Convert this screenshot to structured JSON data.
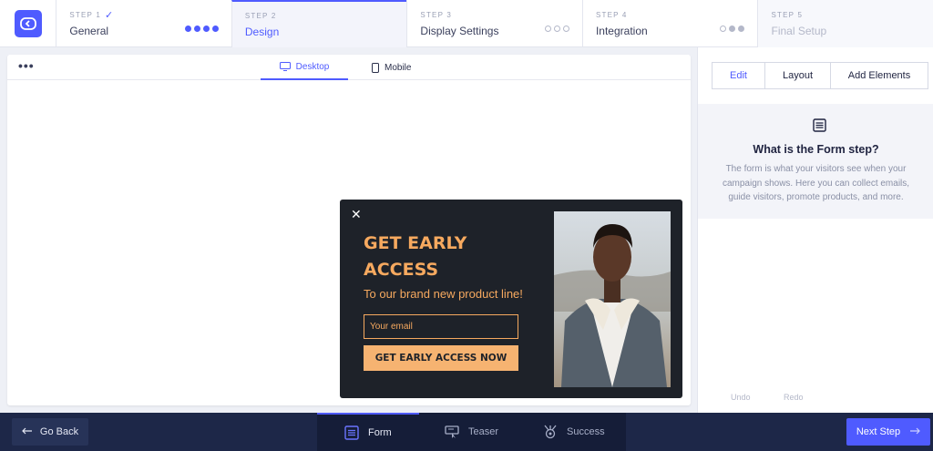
{
  "steps": [
    {
      "num": "STEP 1",
      "title": "General",
      "state": "done",
      "check": "✓"
    },
    {
      "num": "STEP 2",
      "title": "Design",
      "state": "active"
    },
    {
      "num": "STEP 3",
      "title": "Display Settings",
      "state": "upcoming"
    },
    {
      "num": "STEP 4",
      "title": "Integration",
      "state": "upcoming"
    },
    {
      "num": "STEP 5",
      "title": "Final Setup",
      "state": "disabled"
    }
  ],
  "canvas": {
    "tabs": [
      {
        "label": "Desktop",
        "icon": "desktop-icon",
        "active": true
      },
      {
        "label": "Mobile",
        "icon": "mobile-icon",
        "active": false
      }
    ]
  },
  "popup": {
    "close_glyph": "✕",
    "headline": "GET EARLY ACCESS",
    "subline": "To our brand new product line!",
    "email_placeholder": "Your email",
    "cta_label": "GET EARLY ACCESS NOW",
    "accent": "#f6a95f",
    "background": "#1e2229"
  },
  "panel": {
    "tabs": [
      "Edit",
      "Layout",
      "Add Elements"
    ],
    "active_tab": "Edit",
    "info_title": "What is the Form step?",
    "info_text": "The form is what your visitors see when your campaign shows. Here you can collect emails, guide visitors, promote products, and more.",
    "undo": "Undo",
    "redo": "Redo"
  },
  "bottom": {
    "go_back": "Go Back",
    "modes": [
      {
        "label": "Form",
        "icon": "form-icon",
        "active": true
      },
      {
        "label": "Teaser",
        "icon": "teaser-icon",
        "active": false
      },
      {
        "label": "Success",
        "icon": "success-icon",
        "active": false
      }
    ],
    "next_step": "Next Step"
  },
  "colors": {
    "accent": "#4f5bff",
    "bottom_bar": "#1d2748"
  }
}
